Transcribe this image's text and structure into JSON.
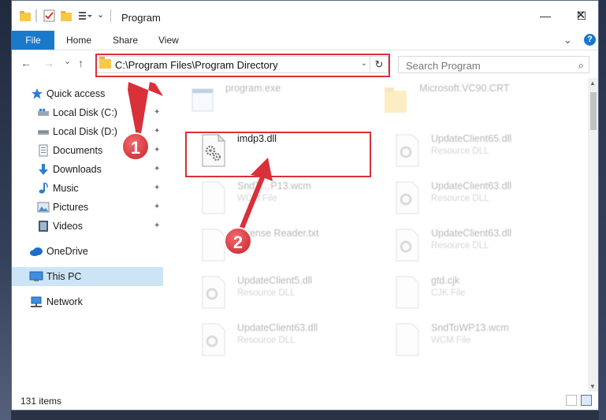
{
  "window": {
    "title": "Program",
    "controls": {
      "minimize": "—",
      "maximize": "☐",
      "close": "✕"
    }
  },
  "ribbon": {
    "tabs": [
      "File",
      "Home",
      "Share",
      "View"
    ],
    "help": "?"
  },
  "navbar": {
    "back": "←",
    "forward": "→",
    "recent": "⌄",
    "up": "↑",
    "address": "C:\\Program Files\\Program Directory",
    "dropdown": "⌄",
    "refresh": "↻",
    "search_placeholder": "Search Program"
  },
  "sidebar": {
    "items": [
      {
        "label": "Quick access",
        "icon": "star-icon",
        "pinned": false
      },
      {
        "label": "Local Disk (C:)",
        "icon": "drive-icon",
        "pinned": true
      },
      {
        "label": "Local Disk (D:)",
        "icon": "drive-icon",
        "pinned": true
      },
      {
        "label": "Documents",
        "icon": "documents-icon",
        "pinned": true
      },
      {
        "label": "Downloads",
        "icon": "download-icon",
        "pinned": true
      },
      {
        "label": "Music",
        "icon": "music-icon",
        "pinned": true
      },
      {
        "label": "Pictures",
        "icon": "pictures-icon",
        "pinned": true
      },
      {
        "label": "Videos",
        "icon": "videos-icon",
        "pinned": true
      },
      {
        "label": "OneDrive",
        "icon": "cloud-icon",
        "pinned": false
      },
      {
        "label": "This PC",
        "icon": "computer-icon",
        "pinned": false
      },
      {
        "label": "Network",
        "icon": "network-icon",
        "pinned": false
      }
    ],
    "pin_glyph": "📌"
  },
  "files": [
    {
      "name": "program.exe",
      "type": "",
      "icon": "exe-icon",
      "faded": true
    },
    {
      "name": "Microsoft.VC90.CRT",
      "type": "",
      "icon": "folder-icon",
      "faded": true
    },
    {
      "name": "imdp3.dll",
      "type": "",
      "icon": "dll-gear-icon",
      "faded": false
    },
    {
      "name": "UpdateClient65.dll",
      "type": "Resource DLL",
      "icon": "dll-gear-icon",
      "faded": true
    },
    {
      "name": "SndT…P13.wcm",
      "type": "WCM File",
      "icon": "file-icon",
      "faded": true
    },
    {
      "name": "UpdateClient63.dll",
      "type": "Resource DLL",
      "icon": "dll-gear-icon",
      "faded": true
    },
    {
      "name": "License Reader.txt",
      "type": "",
      "icon": "file-icon",
      "faded": true
    },
    {
      "name": "UpdateClient63.dll",
      "type": "Resource DLL",
      "icon": "dll-gear-icon",
      "faded": true
    },
    {
      "name": "UpdateClient5.dll",
      "type": "Resource DLL",
      "icon": "dll-gear-icon",
      "faded": true
    },
    {
      "name": "gtd.cjk",
      "type": "CJK File",
      "icon": "file-icon",
      "faded": true
    },
    {
      "name": "UpdateClient63.dll",
      "type": "Resource DLL",
      "icon": "dll-gear-icon",
      "faded": true
    },
    {
      "name": "SndToWP13.wcm",
      "type": "WCM File",
      "icon": "file-icon",
      "faded": true
    }
  ],
  "status": {
    "items_count": "131 items"
  },
  "annotations": [
    {
      "number": "1",
      "color": "#d9303a"
    },
    {
      "number": "2",
      "color": "#d9303a"
    }
  ],
  "colors": {
    "accent": "#1979ca",
    "highlight": "#d9303a",
    "selected": "#cde4f7"
  }
}
